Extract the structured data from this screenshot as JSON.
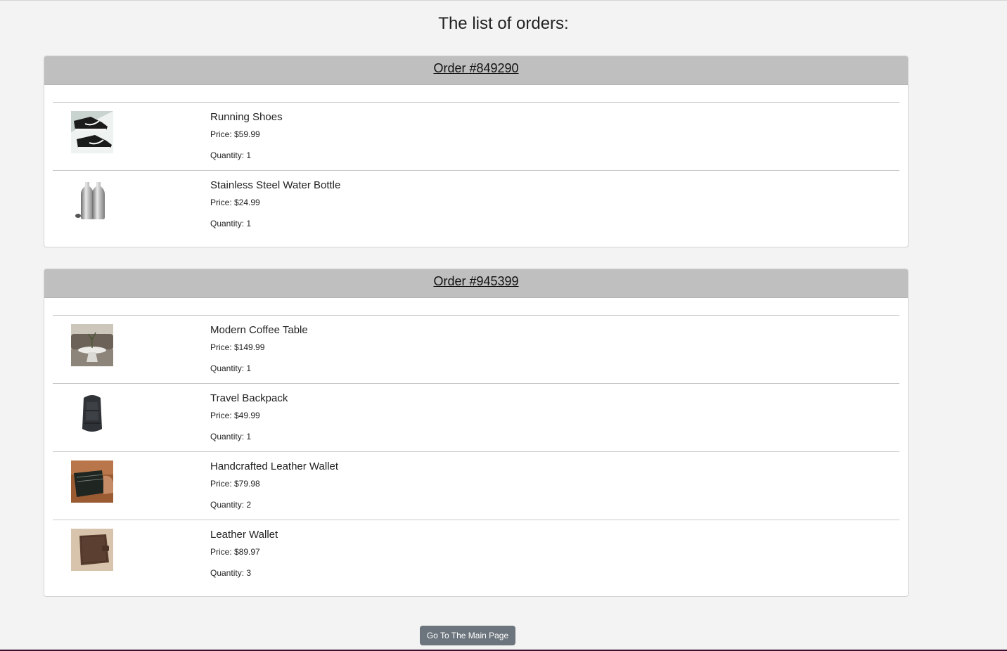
{
  "page": {
    "title": "The list of orders:"
  },
  "orders": [
    {
      "title": "Order #849290",
      "items": [
        {
          "name": "Running Shoes",
          "price": "Price: $59.99",
          "quantity": "Quantity: 1",
          "image_icon": "running-shoes-image"
        },
        {
          "name": "Stainless Steel Water Bottle",
          "price": "Price: $24.99",
          "quantity": "Quantity: 1",
          "image_icon": "water-bottle-image"
        }
      ]
    },
    {
      "title": "Order #945399",
      "items": [
        {
          "name": "Modern Coffee Table",
          "price": "Price: $149.99",
          "quantity": "Quantity: 1",
          "image_icon": "coffee-table-image"
        },
        {
          "name": "Travel Backpack",
          "price": "Price: $49.99",
          "quantity": "Quantity: 1",
          "image_icon": "backpack-image"
        },
        {
          "name": "Handcrafted Leather Wallet",
          "price": "Price: $79.98",
          "quantity": "Quantity: 2",
          "image_icon": "leather-wallet-image"
        },
        {
          "name": "Leather Wallet",
          "price": "Price: $89.97",
          "quantity": "Quantity: 3",
          "image_icon": "wallet-image"
        }
      ]
    }
  ],
  "footer": {
    "main_page_button": "Go To The Main Page"
  },
  "colors": {
    "header_bg": "#c0bfc0",
    "page_bg": "#f3f3f3",
    "button_bg": "#6c757d"
  }
}
